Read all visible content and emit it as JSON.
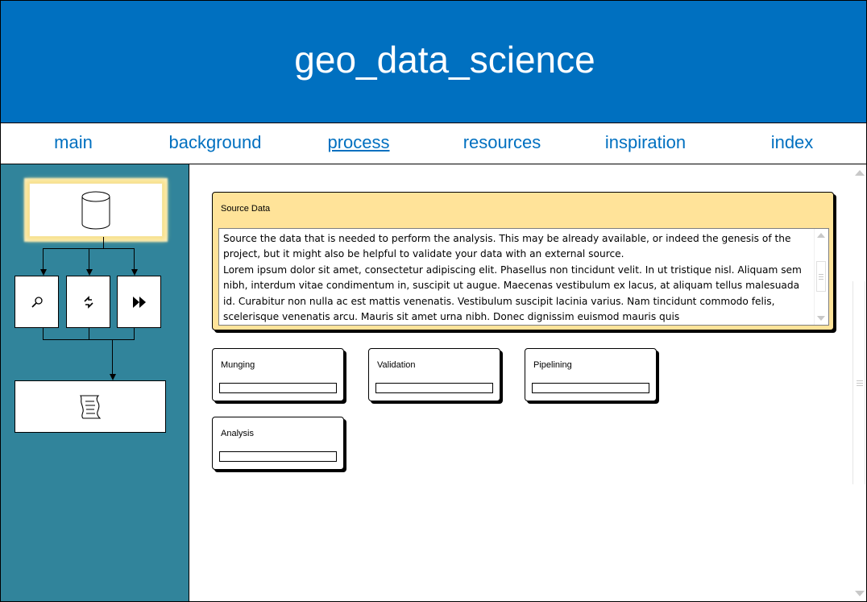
{
  "header": {
    "title": "geo_data_science"
  },
  "nav": {
    "items": [
      {
        "label": "main"
      },
      {
        "label": "background"
      },
      {
        "label": "process",
        "active": true
      },
      {
        "label": "resources"
      },
      {
        "label": "inspiration"
      },
      {
        "label": "index"
      }
    ]
  },
  "sidebar": {
    "flow": {
      "top": {
        "icon": "database-icon"
      },
      "middle": [
        {
          "icon": "search-icon"
        },
        {
          "icon": "transform-icon"
        },
        {
          "icon": "fast-forward-icon"
        }
      ],
      "bottom": {
        "icon": "document-scroll-icon"
      }
    }
  },
  "main": {
    "source_card": {
      "title": "Source Data",
      "paragraphs": [
        "Source the data that is needed to perform the analysis. This may be already available, or indeed the genesis of the project, but it might also be helpful to validate your data with an external source.",
        "Lorem ipsum dolor sit amet, consectetur adipiscing elit. Phasellus non tincidunt velit. In ut tristique nisl. Aliquam sem nibh, interdum vitae condimentum in, suscipit ut augue. Maecenas vestibulum ex lacus, at aliquam tellus malesuada id. Curabitur non nulla ac est mattis venenatis. Vestibulum suscipit lacinia varius. Nam tincidunt commodo felis, scelerisque venenatis arcu. Mauris sit amet urna nibh. Donec dignissim euismod mauris quis"
      ]
    },
    "step_cards": [
      {
        "title": "Munging"
      },
      {
        "title": "Validation"
      },
      {
        "title": "Pipelining"
      },
      {
        "title": "Analysis"
      }
    ]
  },
  "colors": {
    "header_bg": "#0070c0",
    "nav_text": "#0070c0",
    "sidebar_bg": "#31849b",
    "active_card_bg": "#ffe399",
    "glow": "#f8e08a"
  }
}
